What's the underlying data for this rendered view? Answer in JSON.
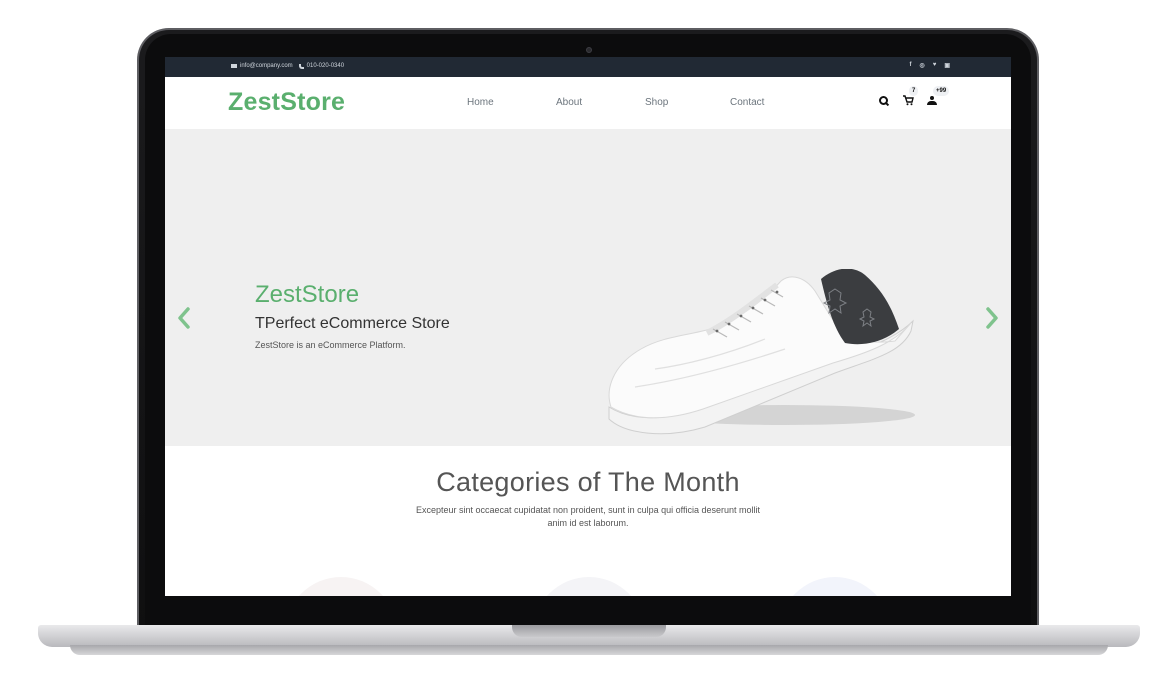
{
  "topbar": {
    "email": "info@company.com",
    "phone": "010-020-0340",
    "socials": [
      "f",
      "◎",
      "♥",
      "▣"
    ]
  },
  "navbar": {
    "logo": "ZestStore",
    "links": [
      "Home",
      "About",
      "Shop",
      "Contact"
    ],
    "cart_count": "7",
    "user_count": "+99"
  },
  "hero": {
    "title": "ZestStore",
    "subtitle": "TPerfect eCommerce Store",
    "description": "ZestStore is an eCommerce Platform."
  },
  "categories": {
    "title": "Categories of The Month",
    "description": "Excepteur sint occaecat cupidatat non proident, sunt in culpa qui officia deserunt mollit anim id est laborum."
  },
  "colors": {
    "accent": "#5aaf6e",
    "topbar": "#212934",
    "hero_bg": "#efefef"
  }
}
